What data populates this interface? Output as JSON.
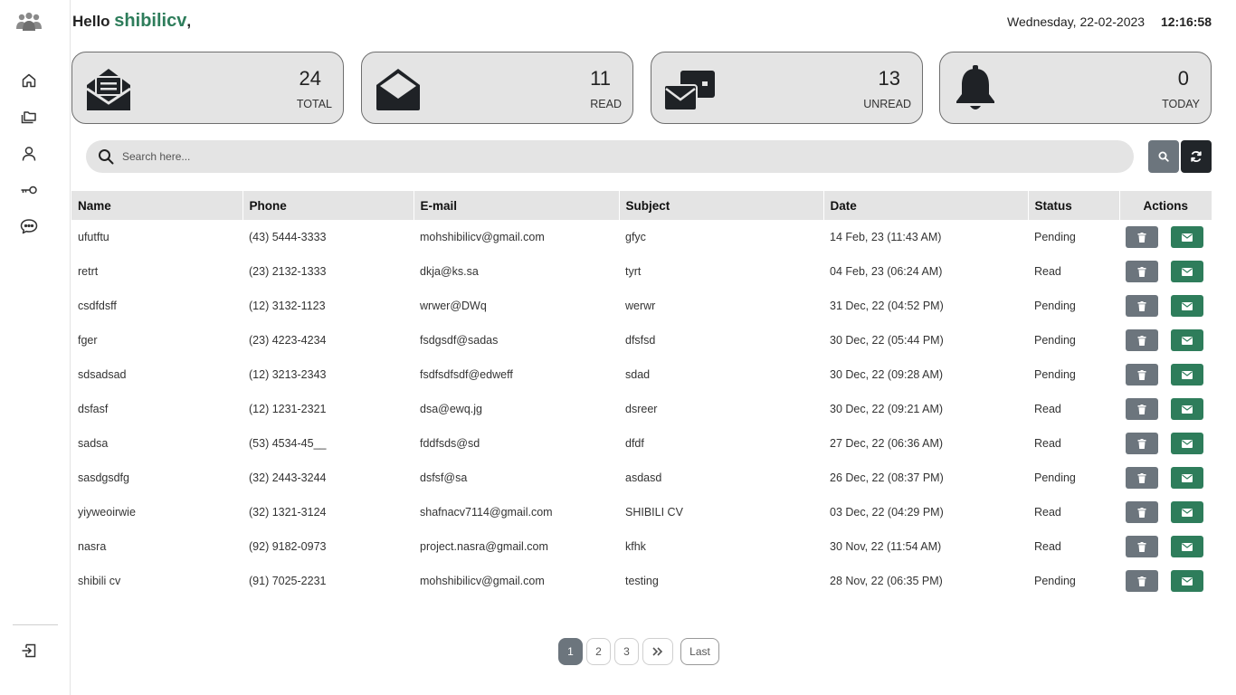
{
  "header": {
    "greeting": "Hello",
    "username": "shibilicv",
    "comma": ",",
    "date": "Wednesday, 22-02-2023",
    "time": "12:16:58"
  },
  "sidebar": {
    "items": [
      {
        "icon": "home-icon"
      },
      {
        "icon": "folders-icon"
      },
      {
        "icon": "user-icon"
      },
      {
        "icon": "key-icon"
      },
      {
        "icon": "chat-icon"
      }
    ],
    "logout_icon": "logout-icon"
  },
  "stats": [
    {
      "value": "24",
      "label": "TOTAL",
      "icon": "mail-open-list-icon"
    },
    {
      "value": "11",
      "label": "READ",
      "icon": "envelope-open-icon"
    },
    {
      "value": "13",
      "label": "UNREAD",
      "icon": "envelopes-icon"
    },
    {
      "value": "0",
      "label": "TODAY",
      "icon": "bell-icon"
    }
  ],
  "search": {
    "placeholder": "Search here..."
  },
  "table": {
    "columns": [
      "Name",
      "Phone",
      "E-mail",
      "Subject",
      "Date",
      "Status",
      "Actions"
    ],
    "rows": [
      {
        "name": "ufutftu",
        "phone": "(43) 5444-3333",
        "email": "mohshibilicv@gmail.com",
        "subject": "gfyc",
        "date": "14 Feb, 23 (11:43 AM)",
        "status": "Pending"
      },
      {
        "name": "retrt",
        "phone": "(23) 2132-1333",
        "email": "dkja@ks.sa",
        "subject": "tyrt",
        "date": "04 Feb, 23 (06:24 AM)",
        "status": "Read"
      },
      {
        "name": "csdfdsff",
        "phone": "(12) 3132-1123",
        "email": "wrwer@DWq",
        "subject": "werwr",
        "date": "31 Dec, 22 (04:52 PM)",
        "status": "Pending"
      },
      {
        "name": "fger",
        "phone": "(23) 4223-4234",
        "email": "fsdgsdf@sadas",
        "subject": "dfsfsd",
        "date": "30 Dec, 22 (05:44 PM)",
        "status": "Pending"
      },
      {
        "name": "sdsadsad",
        "phone": "(12) 3213-2343",
        "email": "fsdfsdfsdf@edweff",
        "subject": "sdad",
        "date": "30 Dec, 22 (09:28 AM)",
        "status": "Pending"
      },
      {
        "name": "dsfasf",
        "phone": "(12) 1231-2321",
        "email": "dsa@ewq.jg",
        "subject": "dsreer",
        "date": "30 Dec, 22 (09:21 AM)",
        "status": "Read"
      },
      {
        "name": "sadsa",
        "phone": "(53) 4534-45__",
        "email": "fddfsds@sd",
        "subject": "dfdf",
        "date": "27 Dec, 22 (06:36 AM)",
        "status": "Read"
      },
      {
        "name": "sasdgsdfg",
        "phone": "(32) 2443-3244",
        "email": "dsfsf@sa",
        "subject": "asdasd",
        "date": "26 Dec, 22 (08:37 PM)",
        "status": "Pending"
      },
      {
        "name": "yiyweoirwie",
        "phone": "(32) 1321-3124",
        "email": "shafnacv7114@gmail.com",
        "subject": "SHIBILI CV",
        "date": "03 Dec, 22 (04:29 PM)",
        "status": "Read"
      },
      {
        "name": "nasra",
        "phone": "(92) 9182-0973",
        "email": "project.nasra@gmail.com",
        "subject": "kfhk",
        "date": "30 Nov, 22 (11:54 AM)",
        "status": "Read"
      },
      {
        "name": "shibili cv",
        "phone": "(91) 7025-2231",
        "email": "mohshibilicv@gmail.com",
        "subject": "testing",
        "date": "28 Nov, 22 (06:35 PM)",
        "status": "Pending"
      }
    ]
  },
  "pagination": {
    "pages": [
      "1",
      "2",
      "3"
    ],
    "active": "1",
    "next": "»",
    "last": "Last"
  },
  "colors": {
    "accent_green": "#2e7d5b",
    "pending_red": "#c0392b",
    "card_bg": "#e4e4e4"
  }
}
